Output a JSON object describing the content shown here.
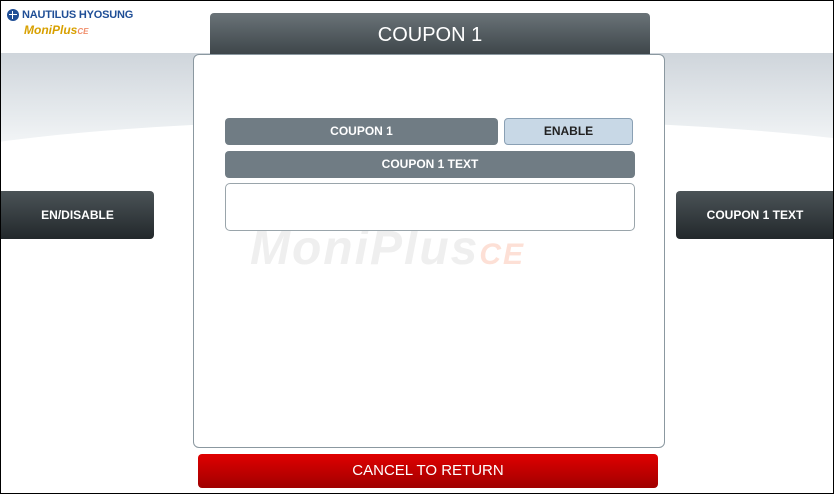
{
  "logo": {
    "brand": "NAUTILUS HYOSUNG",
    "product_main": "MoniPlus",
    "product_suffix": "CE"
  },
  "header": {
    "title": "COUPON 1"
  },
  "panel": {
    "coupon_label": "COUPON 1",
    "status_value": "ENABLE",
    "text_label": "COUPON 1 TEXT",
    "text_value": "",
    "watermark_main": "MoniPlus",
    "watermark_suffix": "CE"
  },
  "side_buttons": {
    "left": "EN/DISABLE",
    "right": "COUPON 1 TEXT"
  },
  "footer": {
    "cancel_label": "CANCEL TO RETURN"
  },
  "colors": {
    "title_bar": "#4f585d",
    "label_bar": "#707c84",
    "enable_box": "#c8d8e6",
    "cancel_button": "#cc0000",
    "brand_blue": "#1f4e96"
  }
}
